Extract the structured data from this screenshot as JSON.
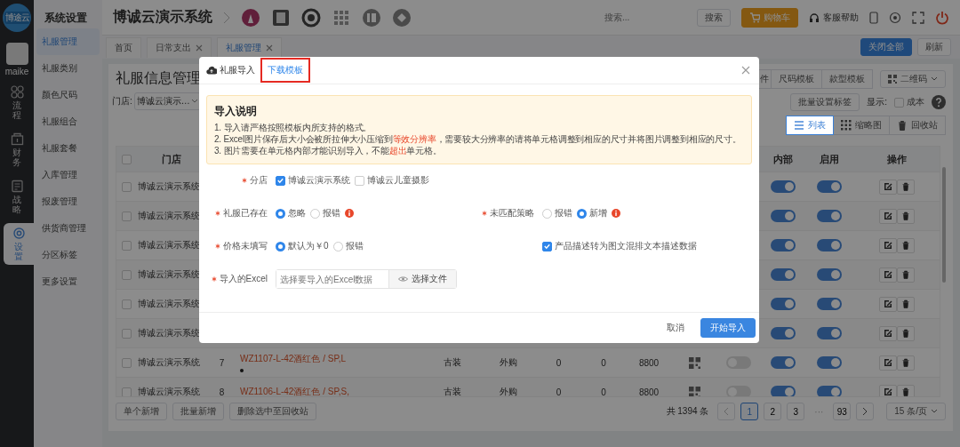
{
  "rail": {
    "logo_text": "博途云",
    "username": "maike",
    "items": [
      {
        "label": "流程",
        "selected": false
      },
      {
        "label": "财务",
        "selected": false
      },
      {
        "label": "战略",
        "selected": false
      },
      {
        "label": "设置",
        "selected": true
      }
    ]
  },
  "sidebar": {
    "title": "系统设置",
    "items": [
      {
        "label": "礼服管理",
        "selected": true
      },
      {
        "label": "礼服类别",
        "selected": false
      },
      {
        "label": "颜色尺码",
        "selected": false
      },
      {
        "label": "礼服组合",
        "selected": false
      },
      {
        "label": "礼服套餐",
        "selected": false
      },
      {
        "label": "入库管理",
        "selected": false
      },
      {
        "label": "报废管理",
        "selected": false
      },
      {
        "label": "供货商管理",
        "selected": false
      },
      {
        "label": "分区标签",
        "selected": false
      },
      {
        "label": "更多设置",
        "selected": false
      }
    ]
  },
  "header": {
    "title": "博诚云演示系统",
    "search_placeholder": "搜索...",
    "search_button": "搜索",
    "cart_button": "购物车",
    "help": "客服帮助"
  },
  "tabs": [
    {
      "label": "首页",
      "closable": false,
      "selected": false
    },
    {
      "label": "日常支出",
      "closable": true,
      "selected": false
    },
    {
      "label": "礼服管理",
      "closable": true,
      "selected": true
    }
  ],
  "tab_actions": [
    {
      "label": "关闭全部",
      "kind": "primary"
    },
    {
      "label": "刷新",
      "kind": "default"
    }
  ],
  "page": {
    "title": "礼服信息管理",
    "store_filter": {
      "label": "门店:",
      "value": "博诚云演示…"
    },
    "template_buttons": [
      "件",
      "尺码模板",
      "款型模板"
    ],
    "qr_button": "二维码",
    "batch_tag_button": "批量设置标签",
    "display_label": "显示:",
    "cost_option": {
      "label": "成本",
      "checked": false
    },
    "views": [
      {
        "label": "列表",
        "selected": true
      },
      {
        "label": "缩略图",
        "selected": false
      },
      {
        "label": "回收站",
        "selected": false
      }
    ]
  },
  "table": {
    "select_all_checked": false,
    "columns": [
      "门店",
      "内部",
      "启用",
      "操作"
    ],
    "rows": [
      {
        "kind": "partial",
        "checked": false,
        "store": "博诚云演示系统",
        "internal": true,
        "enabled": true
      },
      {
        "kind": "partial",
        "checked": false,
        "store": "博诚云演示系统",
        "internal": true,
        "enabled": true
      },
      {
        "kind": "partial",
        "checked": false,
        "store": "博诚云演示系统",
        "internal": true,
        "enabled": true
      },
      {
        "kind": "partial",
        "checked": false,
        "store": "博诚云演示系统",
        "internal": true,
        "enabled": true
      },
      {
        "kind": "partial",
        "checked": false,
        "store": "博诚云演示系统",
        "internal": true,
        "enabled": true
      },
      {
        "kind": "partial",
        "checked": false,
        "store": "博诚云演示系统",
        "internal": true,
        "enabled": true
      },
      {
        "kind": "full",
        "checked": false,
        "store": "博诚云演示系统",
        "number": "7",
        "product": "WZ1107-L-42酒红色 / SP,L",
        "marker": true,
        "category": "古装",
        "source": "外购",
        "column_7": "0",
        "column_8": "0",
        "price": "8800",
        "toggle": false,
        "internal": true,
        "enabled": true
      },
      {
        "kind": "full",
        "checked": false,
        "store": "博诚云演示系统",
        "number": "8",
        "product": "WZ1106-L-42酒红色 / SP,S,",
        "category": "古装",
        "source": "外购",
        "column_7": "0",
        "column_8": "0",
        "price": "8800",
        "toggle": false,
        "internal": true,
        "enabled": true
      }
    ]
  },
  "bulk_actions": [
    "单个新增",
    "批量新增",
    "删除选中至回收站"
  ],
  "pagination": {
    "total": "共 1394 条",
    "pages": [
      {
        "label": "1",
        "kind": "page",
        "selected": true
      },
      {
        "label": "2",
        "kind": "page",
        "selected": false
      },
      {
        "label": "3",
        "kind": "page",
        "selected": false
      },
      {
        "label": "···",
        "kind": "ellipsis"
      },
      {
        "label": "93",
        "kind": "page",
        "selected": false
      }
    ],
    "page_size": "15 条/页"
  },
  "modal": {
    "title": "礼服导入",
    "download_link": "下载模板",
    "link_highlighted": true,
    "notice": {
      "title": "导入说明",
      "lines": [
        [
          {
            "text": "1. 导入请严格按照模板内所支持的格式。",
            "emphasis": false
          }
        ],
        [
          {
            "text": "2. Excel图片保存后大小会被所拉伸大小压缩到",
            "emphasis": false
          },
          {
            "text": "等效分辨率",
            "emphasis": true
          },
          {
            "text": "，需要较大分辨率的请将单元格调整到相应的尺寸并将图片调整到相应的尺寸。",
            "emphasis": false
          }
        ],
        [
          {
            "text": "3. 图片需要在单元格内部才能识别导入，不能",
            "emphasis": false
          },
          {
            "text": "超出",
            "emphasis": true
          },
          {
            "text": "单元格。",
            "emphasis": false
          }
        ]
      ]
    },
    "fields": [
      {
        "kind": "checkboxes",
        "label": "分店",
        "required": true,
        "options": [
          {
            "label": "博诚云演示系统",
            "checked": true
          },
          {
            "label": "博诚云儿童摄影",
            "checked": false
          }
        ]
      },
      {
        "kind": "radios",
        "label": "礼服已存在",
        "required": true,
        "info": true,
        "options": [
          {
            "label": "忽略",
            "selected": true
          },
          {
            "label": "报错",
            "selected": false
          }
        ]
      },
      {
        "kind": "radios",
        "label": "未匹配策略",
        "required": true,
        "info": true,
        "options": [
          {
            "label": "报错",
            "selected": false
          },
          {
            "label": "新增",
            "selected": true
          }
        ]
      },
      {
        "kind": "radios",
        "label": "价格未填写",
        "required": true,
        "options": [
          {
            "label": "默认为￥0",
            "selected": true
          },
          {
            "label": "报错",
            "selected": false
          }
        ]
      },
      {
        "kind": "checkbox",
        "label": "产品描述转为图文混排文本描述数据",
        "checked": true
      },
      {
        "kind": "file",
        "label": "导入的Excel",
        "required": true,
        "placeholder": "选择要导入的Excel数据",
        "button": "选择文件"
      }
    ],
    "cancel": "取消",
    "submit": "开始导入"
  }
}
